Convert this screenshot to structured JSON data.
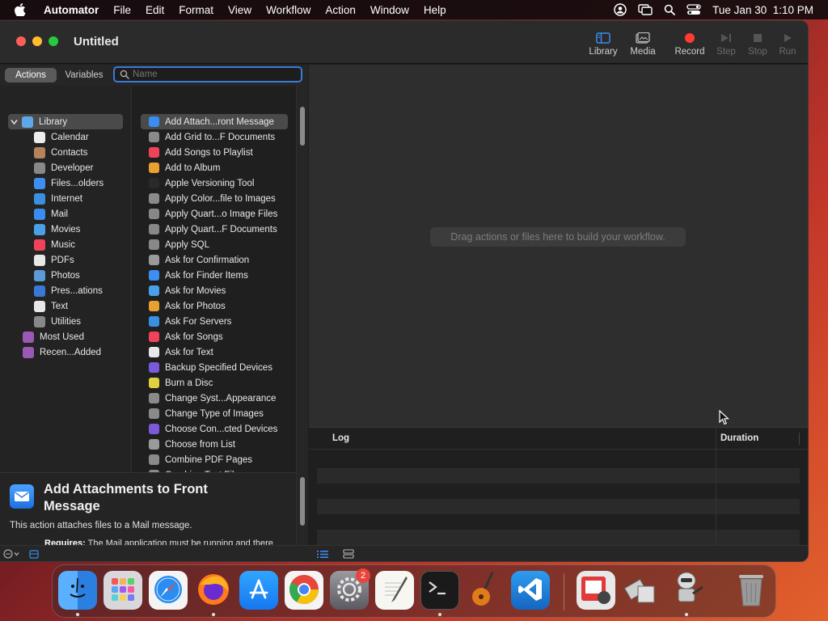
{
  "menubar": {
    "app": "Automator",
    "items": [
      "File",
      "Edit",
      "Format",
      "View",
      "Workflow",
      "Action",
      "Window",
      "Help"
    ],
    "clock": "Tue Jan 30  1:10 PM"
  },
  "window": {
    "title": "Untitled",
    "toolbar": {
      "library": "Library",
      "media": "Media",
      "record": "Record",
      "step": "Step",
      "stop": "Stop",
      "run": "Run"
    }
  },
  "library": {
    "tab_actions": "Actions",
    "tab_variables": "Variables",
    "search_placeholder": "Name",
    "categories": [
      {
        "label": "Library",
        "icon": "library-folder-icon",
        "color": "#5fa8e8"
      },
      {
        "label": "Calendar",
        "icon": "calendar-icon",
        "color": "#ececec"
      },
      {
        "label": "Contacts",
        "icon": "contacts-icon",
        "color": "#b5835a"
      },
      {
        "label": "Developer",
        "icon": "developer-tools-icon",
        "color": "#888888"
      },
      {
        "label": "Files...olders",
        "icon": "finder-icon",
        "color": "#3d8ef0"
      },
      {
        "label": "Internet",
        "icon": "globe-icon",
        "color": "#3a90e0"
      },
      {
        "label": "Mail",
        "icon": "mail-icon",
        "color": "#3a8cf0"
      },
      {
        "label": "Movies",
        "icon": "movies-icon",
        "color": "#4aa0e8"
      },
      {
        "label": "Music",
        "icon": "music-icon",
        "color": "#f0435a"
      },
      {
        "label": "PDFs",
        "icon": "pdf-icon",
        "color": "#e8e8e8"
      },
      {
        "label": "Photos",
        "icon": "photos-icon",
        "color": "#5a9ad8"
      },
      {
        "label": "Pres...ations",
        "icon": "presentations-icon",
        "color": "#3a78d8"
      },
      {
        "label": "Text",
        "icon": "text-icon",
        "color": "#e8e8e8"
      },
      {
        "label": "Utilities",
        "icon": "utilities-icon",
        "color": "#888888"
      },
      {
        "label": "Most Used",
        "icon": "smart-folder-icon",
        "color": "#9b59b6"
      },
      {
        "label": "Recen...Added",
        "icon": "smart-folder-icon",
        "color": "#9b59b6"
      }
    ],
    "actions": [
      {
        "label": "Add Attach...ront Message",
        "color": "#3a8cf0"
      },
      {
        "label": "Add Grid to...F Documents",
        "color": "#8a8a8a"
      },
      {
        "label": "Add Songs to Playlist",
        "color": "#f0435a"
      },
      {
        "label": "Add to Album",
        "color": "#e8a030"
      },
      {
        "label": "Apple Versioning Tool",
        "color": "#2a2a2a"
      },
      {
        "label": "Apply Color...file to Images",
        "color": "#8a8a8a"
      },
      {
        "label": "Apply Quart...o Image Files",
        "color": "#888888"
      },
      {
        "label": "Apply Quart...F Documents",
        "color": "#888888"
      },
      {
        "label": "Apply SQL",
        "color": "#888888"
      },
      {
        "label": "Ask for Confirmation",
        "color": "#9a9a9a"
      },
      {
        "label": "Ask for Finder Items",
        "color": "#3d8ef0"
      },
      {
        "label": "Ask for Movies",
        "color": "#4aa0e8"
      },
      {
        "label": "Ask for Photos",
        "color": "#e8a030"
      },
      {
        "label": "Ask For Servers",
        "color": "#3a90e0"
      },
      {
        "label": "Ask for Songs",
        "color": "#f0435a"
      },
      {
        "label": "Ask for Text",
        "color": "#e8e8e8"
      },
      {
        "label": "Backup Specified Devices",
        "color": "#7a5ad8"
      },
      {
        "label": "Burn a Disc",
        "color": "#e0d040"
      },
      {
        "label": "Change Syst...Appearance",
        "color": "#8a8a8a"
      },
      {
        "label": "Change Type of Images",
        "color": "#8a8a8a"
      },
      {
        "label": "Choose Con...cted Devices",
        "color": "#7a5ad8"
      },
      {
        "label": "Choose from List",
        "color": "#9a9a9a"
      },
      {
        "label": "Combine PDF Pages",
        "color": "#8a8a8a"
      },
      {
        "label": "Combine Text Files",
        "color": "#8a8a8a"
      }
    ]
  },
  "description": {
    "title": "Add Attachments to Front Message",
    "text": "This action attaches files to a Mail message.",
    "requires_label": "Requires:",
    "requires_text": "The Mail application must be running and there must be an outgoing message."
  },
  "workflow": {
    "hint": "Drag actions or files here to build your workflow."
  },
  "log": {
    "col_log": "Log",
    "col_duration": "Duration"
  },
  "dock": {
    "badge_count": "2"
  },
  "colors": {
    "accent": "#3a7bd5",
    "record": "#ff3b30"
  }
}
